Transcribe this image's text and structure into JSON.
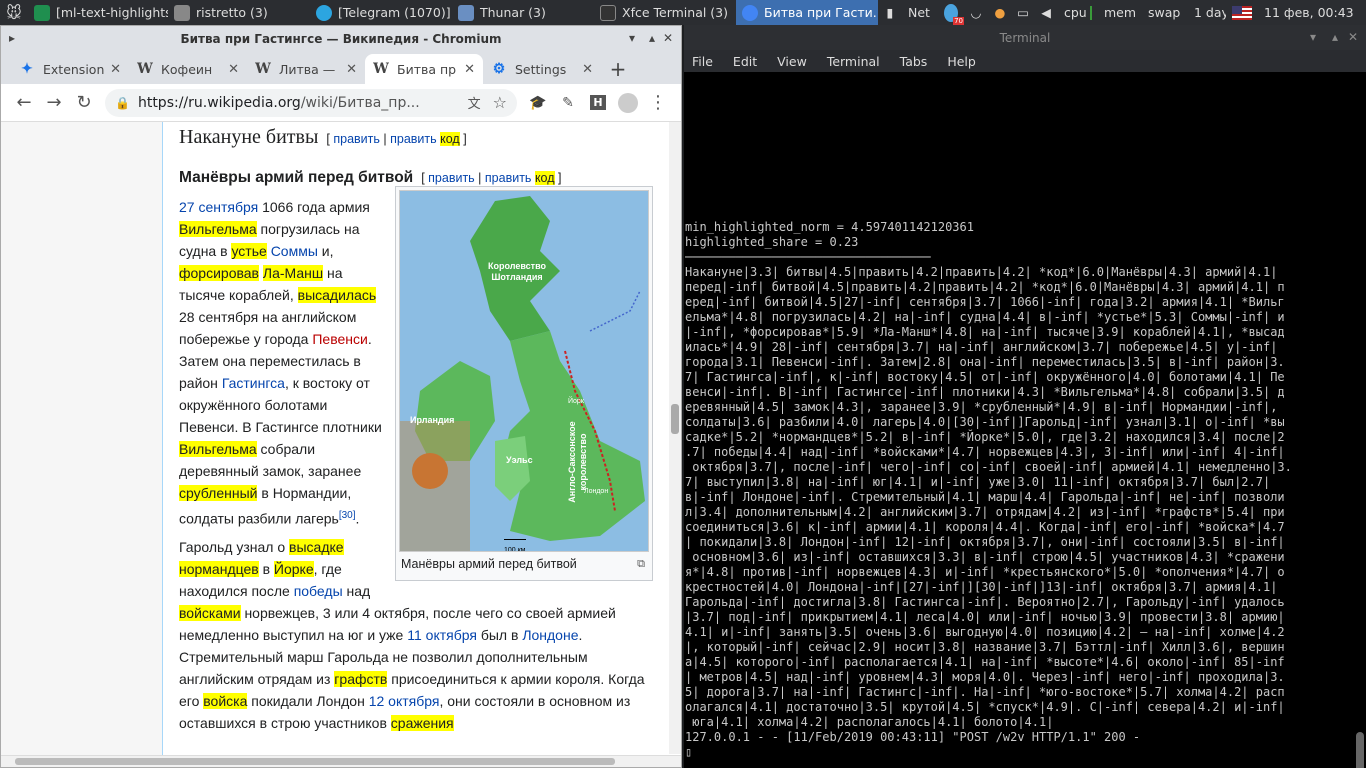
{
  "panel": {
    "apps": [
      {
        "label": "[ml-text-highlights...",
        "icon_color": "#1f8f4f"
      },
      {
        "label": "ristretto (3)",
        "icon_color": "#888888"
      },
      {
        "label": "[Telegram (1070)]",
        "icon_color": "#2ca5e0"
      },
      {
        "label": "Thunar (3)",
        "icon_color": "#6a8fc2"
      },
      {
        "label": "Xfce Terminal (3)",
        "icon_color": "#333333"
      },
      {
        "label": "Битва при Гасти...",
        "icon_color": "#4285f4"
      }
    ],
    "tray": {
      "net": "Net",
      "badge": "70",
      "cpu": "cpu",
      "mem": "mem",
      "swap": "swap",
      "layout_day": "1 day",
      "datetime": "11 фев, 00:43"
    }
  },
  "chrome": {
    "title": "Битва при Гастингсе — Википедия - Chromium",
    "tabs": [
      {
        "label": "Extension",
        "fav": "✦"
      },
      {
        "label": "Кофеин",
        "fav": "W"
      },
      {
        "label": "Литва —",
        "fav": "W"
      },
      {
        "label": "Битва пр",
        "fav": "W"
      },
      {
        "label": "Settings",
        "fav": "⚙"
      }
    ],
    "url_host": "https://ru.wikipedia.org",
    "url_path": "/wiki/Битва_пр..."
  },
  "article": {
    "h2": "Накануне битвы",
    "h3": "Манёвры армий перед битвой",
    "edit": "править",
    "code": "код",
    "caption": "Манёвры армий перед битвой",
    "map_labels": {
      "scotland": "Королевство Шотландия",
      "ireland": "Ирландия",
      "wales": "Уэльс",
      "anglo": "Англо-Саксонское королевство",
      "york": "Йорк",
      "london": "Лондон",
      "scale": "100 км"
    }
  },
  "terminal": {
    "title": "Terminal",
    "menu": [
      "File",
      "Edit",
      "View",
      "Terminal",
      "Tabs",
      "Help"
    ],
    "lines": [
      "min_highlighted_norm = 4.597401142120361",
      "highlighted_share = 0.23",
      "──────────────────────────────────",
      "Накануне|3.3| битвы|4.5|править|4.2|править|4.2| *код*|6.0|Манёвры|4.3| армий|4.1|",
      "перед|-inf| битвой|4.5|править|4.2|править|4.2| *код*|6.0|Манёвры|4.3| армий|4.1| п",
      "еред|-inf| битвой|4.5|27|-inf| сентября|3.7| 1066|-inf| года|3.2| армия|4.1| *Вильг",
      "ельма*|4.8| погрузилась|4.2| на|-inf| судна|4.4| в|-inf| *устье*|5.3| Соммы|-inf| и",
      "|-inf|, *форсировав*|5.9| *Ла-Манш*|4.8| на|-inf| тысяче|3.9| кораблей|4.1|, *высад",
      "илась*|4.9| 28|-inf| сентября|3.7| на|-inf| английском|3.7| побережье|4.5| у|-inf|",
      "города|3.1| Певенси|-inf|. Затем|2.8| она|-inf| переместилась|3.5| в|-inf| район|3.",
      "7| Гастингса|-inf|, к|-inf| востоку|4.5| от|-inf| окружённого|4.0| болотами|4.1| Пе",
      "венси|-inf|. В|-inf| Гастингсе|-inf| плотники|4.3| *Вильгельма*|4.8| собрали|3.5| д",
      "еревянный|4.5| замок|4.3|, заранее|3.9| *срубленный*|4.9| в|-inf| Нормандии|-inf|,",
      "солдаты|3.6| разбили|4.0| лагерь|4.0|[30|-inf|]Гарольд|-inf| узнал|3.1| о|-inf| *вы",
      "садке*|5.2| *нормандцев*|5.2| в|-inf| *Йорке*|5.0|, где|3.2| находился|3.4| после|2",
      ".7| победы|4.4| над|-inf| *войсками*|4.7| норвежцев|4.3|, 3|-inf| или|-inf| 4|-inf|",
      " октября|3.7|, после|-inf| чего|-inf| со|-inf| своей|-inf| армией|4.1| немедленно|3.",
      "7| выступил|3.8| на|-inf| юг|4.1| и|-inf| уже|3.0| 11|-inf| октября|3.7| был|2.7|",
      "в|-inf| Лондоне|-inf|. Стремительный|4.1| марш|4.4| Гарольда|-inf| не|-inf| позволи",
      "л|3.4| дополнительным|4.2| английским|3.7| отрядам|4.2| из|-inf| *графств*|5.4| при",
      "соединиться|3.6| к|-inf| армии|4.1| короля|4.4|. Когда|-inf| его|-inf| *войска*|4.7",
      "| покидали|3.8| Лондон|-inf| 12|-inf| октября|3.7|, они|-inf| состояли|3.5| в|-inf|",
      " основном|3.6| из|-inf| оставшихся|3.3| в|-inf| строю|4.5| участников|4.3| *сражени",
      "я*|4.8| против|-inf| норвежцев|4.3| и|-inf| *крестьянского*|5.0| *ополчения*|4.7| о",
      "крестностей|4.0| Лондона|-inf|[27|-inf|][30|-inf|]13|-inf| октября|3.7| армия|4.1|",
      "Гарольда|-inf| достигла|3.8| Гастингса|-inf|. Вероятно|2.7|, Гарольду|-inf| удалось",
      "|3.7| под|-inf| прикрытием|4.1| леса|4.0| или|-inf| ночью|3.9| провести|3.8| армию|",
      "4.1| и|-inf| занять|3.5| очень|3.6| выгодную|4.0| позицию|4.2| — на|-inf| холме|4.2",
      "|, который|-inf| сейчас|2.9| носит|3.8| название|3.7| Бэттл|-inf| Хилл|3.6|, вершин",
      "а|4.5| которого|-inf| располагается|4.1| на|-inf| *высоте*|4.6| около|-inf| 85|-inf",
      "| метров|4.5| над|-inf| уровнем|4.3| моря|4.0|. Через|-inf| него|-inf| проходила|3.",
      "5| дорога|3.7| на|-inf| Гастингс|-inf|. На|-inf| *юго-востоке*|5.7| холма|4.2| расп",
      "олагался|4.1| достаточно|3.5| крутой|4.5| *спуск*|4.9|. С|-inf| севера|4.2| и|-inf|",
      " юга|4.1| холма|4.2| располагалось|4.1| болото|4.1|",
      "127.0.0.1 - - [11/Feb/2019 00:43:11] \"POST /w2v HTTP/1.1\" 200 -",
      "▯"
    ]
  }
}
